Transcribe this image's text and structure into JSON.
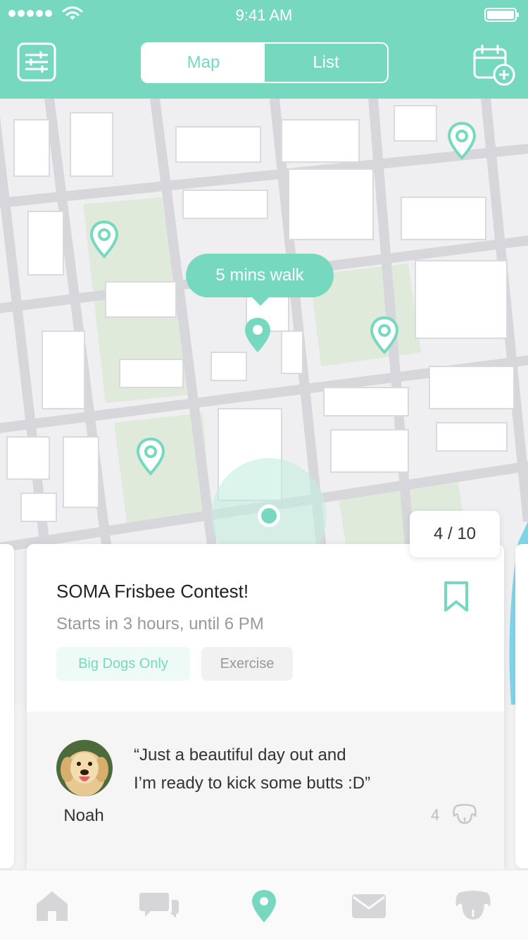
{
  "status_bar": {
    "time": "9:41 AM"
  },
  "header": {
    "segments": [
      {
        "label": "Map",
        "active": true
      },
      {
        "label": "List",
        "active": false
      }
    ],
    "icons": {
      "filter": "sliders-icon",
      "calendar_add": "calendar-add-icon"
    }
  },
  "map": {
    "tooltip": "5 mins walk",
    "counter": "4 / 10"
  },
  "event": {
    "title": "SOMA Frisbee Contest!",
    "subtitle": "Starts in 3 hours, until 6 PM",
    "tags": [
      "Big Dogs Only",
      "Exercise"
    ],
    "comment": {
      "author": "Noah",
      "line1": "“Just a beautiful day out and",
      "line2": "I’m ready to kick some butts :D”",
      "likes": "4"
    }
  },
  "tabbar": {
    "items": [
      "home-icon",
      "chat-icon",
      "location-pin-icon",
      "mail-icon",
      "dog-icon"
    ],
    "active_index": 2
  },
  "colors": {
    "accent": "#76d9bf",
    "water": "#7fd3e6"
  }
}
